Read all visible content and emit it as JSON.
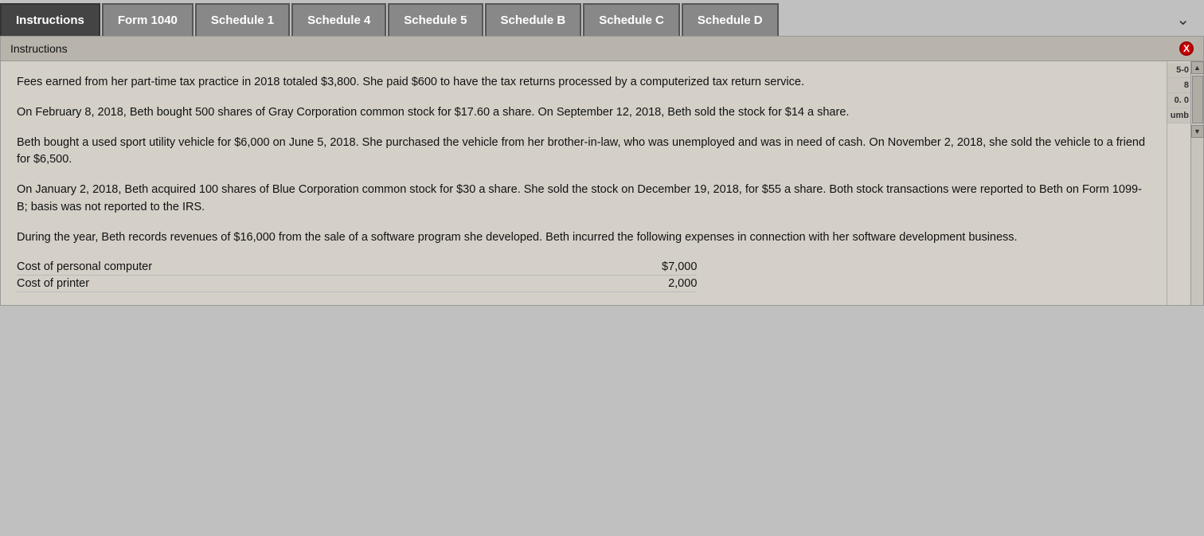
{
  "tabs": [
    {
      "id": "instructions",
      "label": "Instructions",
      "active": true
    },
    {
      "id": "form1040",
      "label": "Form 1040",
      "active": false
    },
    {
      "id": "schedule1",
      "label": "Schedule 1",
      "active": false
    },
    {
      "id": "schedule4",
      "label": "Schedule 4",
      "active": false
    },
    {
      "id": "schedule5",
      "label": "Schedule 5",
      "active": false
    },
    {
      "id": "scheduleB",
      "label": "Schedule B",
      "active": false
    },
    {
      "id": "scheduleC",
      "label": "Schedule C",
      "active": false
    },
    {
      "id": "scheduleD",
      "label": "Schedule D",
      "active": false
    }
  ],
  "dropdown_label": "❯",
  "panel": {
    "title": "Instructions",
    "close_label": "X"
  },
  "paragraphs": [
    "Fees earned from her part-time tax practice in 2018 totaled $3,800. She paid $600 to have the tax returns processed by a computerized tax return service.",
    "On February 8, 2018, Beth bought 500 shares of Gray Corporation common stock for $17.60 a share. On September 12, 2018, Beth sold the stock for $14 a share.",
    "Beth bought a used sport utility vehicle for $6,000 on June 5, 2018. She purchased the vehicle from her brother-in-law, who was unemployed and was in need of cash. On November 2, 2018, she sold the vehicle to a friend for $6,500.",
    "On January 2, 2018, Beth acquired 100 shares of Blue Corporation common stock for $30 a share. She sold the stock on December 19, 2018, for $55 a share. Both stock transactions were reported to Beth on Form 1099-B; basis was not reported to the IRS.",
    "During the year, Beth records revenues of $16,000 from the sale of a software program she developed. Beth incurred the following expenses in connection with her software development business."
  ],
  "expenses": [
    {
      "label": "Cost of personal computer",
      "value": "$7,000"
    },
    {
      "label": "Cost of printer",
      "value": "2,000"
    }
  ],
  "right_labels": [
    "5-0",
    "8",
    "0. 0",
    "umb"
  ],
  "scrollbar": {
    "up_arrow": "▲",
    "down_arrow": "▼"
  }
}
